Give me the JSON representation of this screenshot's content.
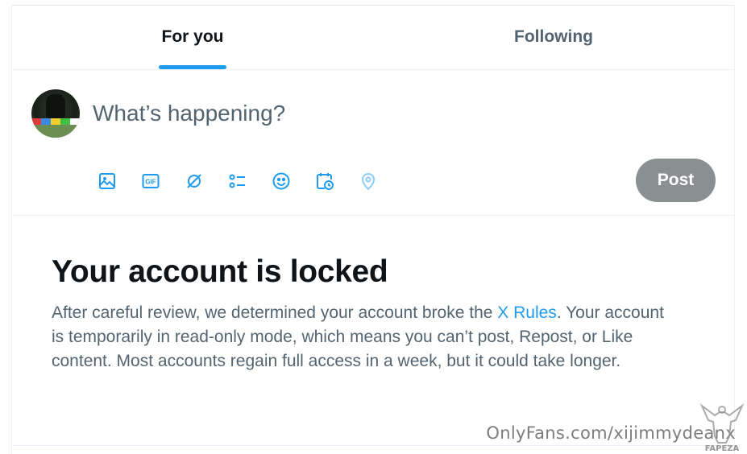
{
  "tabs": [
    {
      "label": "For you",
      "active": true
    },
    {
      "label": "Following",
      "active": false
    }
  ],
  "composer": {
    "placeholder": "What’s happening?",
    "post_label": "Post",
    "tools": [
      "image-icon",
      "gif-icon",
      "grok-icon",
      "poll-icon",
      "emoji-icon",
      "schedule-icon",
      "location-icon"
    ]
  },
  "notice": {
    "title": "Your account is locked",
    "body_before": "After careful review, we determined your account broke the ",
    "link": "X Rules",
    "body_after": ". Your account is temporarily in read-only mode, which means you can’t post, Repost, or Like content. Most accounts regain full access in a week, but it could take longer."
  },
  "watermark": {
    "text": "OnlyFans.com/xijimmydeanx",
    "logo": "FAPEZA"
  },
  "colors": {
    "accent": "#1d9bf0",
    "text": "#0f1419",
    "secondary": "#536471",
    "post_disabled": "#8a8f92"
  }
}
